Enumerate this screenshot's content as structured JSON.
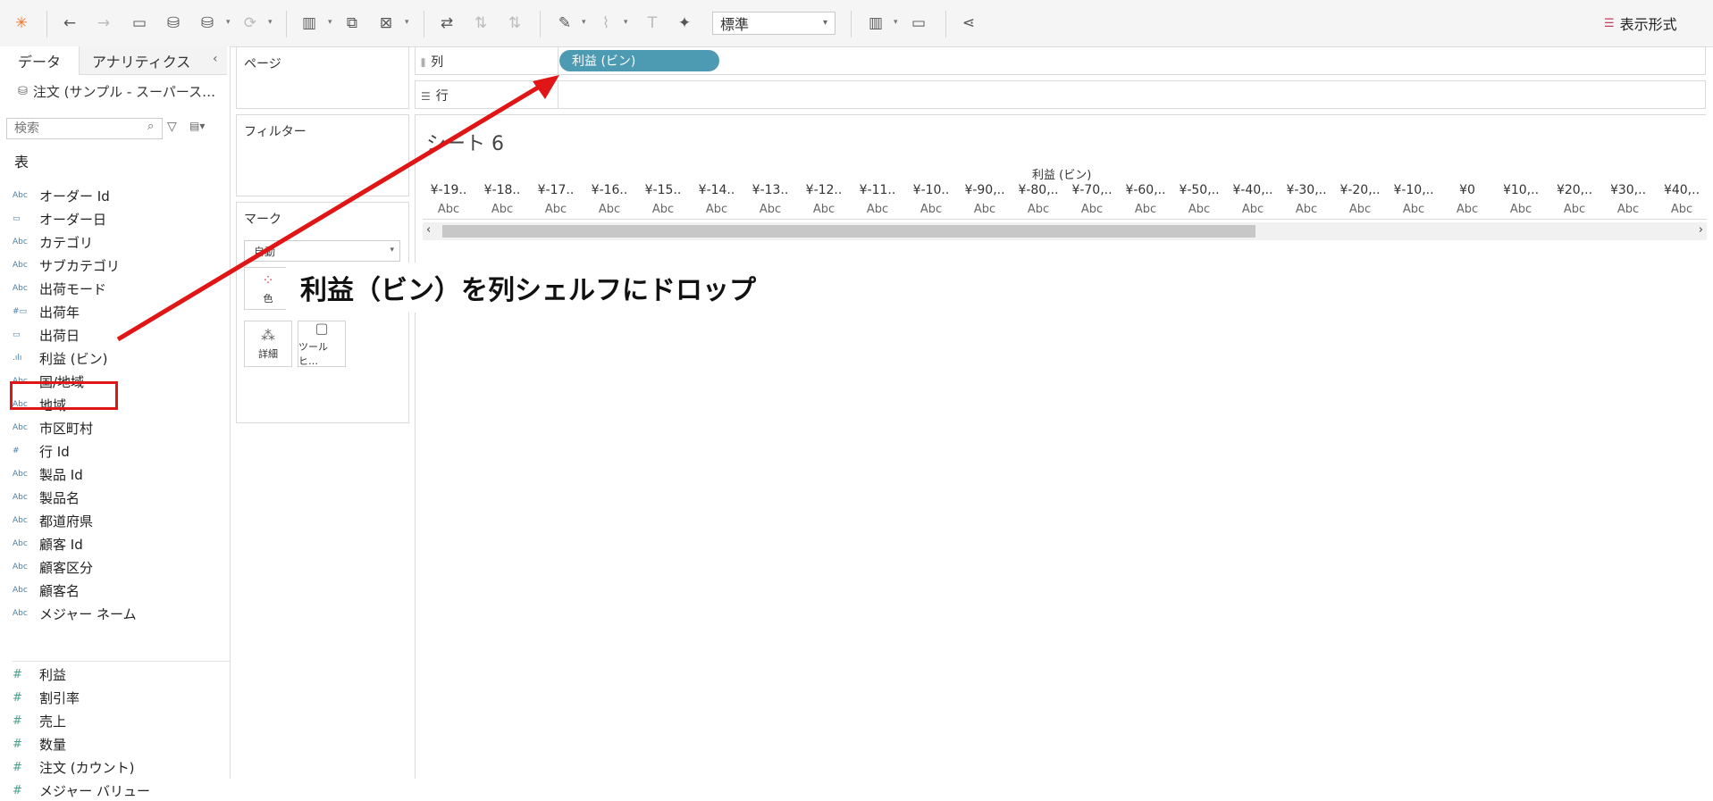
{
  "toolbar": {
    "mode_value": "標準",
    "show_me_label": "表示形式"
  },
  "left_pane": {
    "tab_data": "データ",
    "tab_analytics": "アナリティクス",
    "datasource_name": "注文 (サンプル - スーパース…",
    "search_placeholder": "検索",
    "section_table": "表",
    "dimensions": [
      {
        "type": "Abc",
        "name": "オーダー Id"
      },
      {
        "type": "date",
        "name": "オーダー日"
      },
      {
        "type": "Abc",
        "name": "カテゴリ"
      },
      {
        "type": "Abc",
        "name": "サブカテゴリ"
      },
      {
        "type": "Abc",
        "name": "出荷モード"
      },
      {
        "type": "#date",
        "name": "出荷年"
      },
      {
        "type": "date",
        "name": "出荷日"
      },
      {
        "type": "bin",
        "name": "利益 (ビン)"
      },
      {
        "type": "Abc",
        "name": "国/地域"
      },
      {
        "type": "Abc",
        "name": "地域"
      },
      {
        "type": "Abc",
        "name": "市区町村"
      },
      {
        "type": "#",
        "name": "行 Id"
      },
      {
        "type": "Abc",
        "name": "製品 Id"
      },
      {
        "type": "Abc",
        "name": "製品名"
      },
      {
        "type": "Abc",
        "name": "都道府県"
      },
      {
        "type": "Abc",
        "name": "顧客 Id"
      },
      {
        "type": "Abc",
        "name": "顧客区分"
      },
      {
        "type": "Abc",
        "name": "顧客名"
      },
      {
        "type": "Abc",
        "name": "メジャー ネーム"
      }
    ],
    "measures": [
      {
        "type": "#",
        "name": "利益"
      },
      {
        "type": "#",
        "name": "割引率"
      },
      {
        "type": "#",
        "name": "売上"
      },
      {
        "type": "#",
        "name": "数量"
      },
      {
        "type": "#",
        "name": "注文 (カウント)"
      },
      {
        "type": "#",
        "name": "メジャー バリュー"
      }
    ]
  },
  "cards": {
    "pages": "ページ",
    "filters": "フィルター",
    "marks": "マーク",
    "marks_type": "自動",
    "color": "色",
    "detail": "詳細",
    "tooltip": "ツールヒ…"
  },
  "shelves": {
    "columns_label": "列",
    "rows_label": "行",
    "column_pill": "利益 (ビン)"
  },
  "viz": {
    "sheet_title": "シート 6",
    "axis_title": "利益 (ビン)",
    "ticks": [
      "¥-19..",
      "¥-18..",
      "¥-17..",
      "¥-16..",
      "¥-15..",
      "¥-14..",
      "¥-13..",
      "¥-12..",
      "¥-11..",
      "¥-10..",
      "¥-90,..",
      "¥-80,..",
      "¥-70,..",
      "¥-60,..",
      "¥-50,..",
      "¥-40,..",
      "¥-30,..",
      "¥-20,..",
      "¥-10,..",
      "¥0",
      "¥10,..",
      "¥20,..",
      "¥30,..",
      "¥40,.."
    ],
    "cell_text": "Abc"
  },
  "annotation": {
    "callout": "利益（ビン）を列シェルフにドロップ",
    "color": "#e01515"
  }
}
